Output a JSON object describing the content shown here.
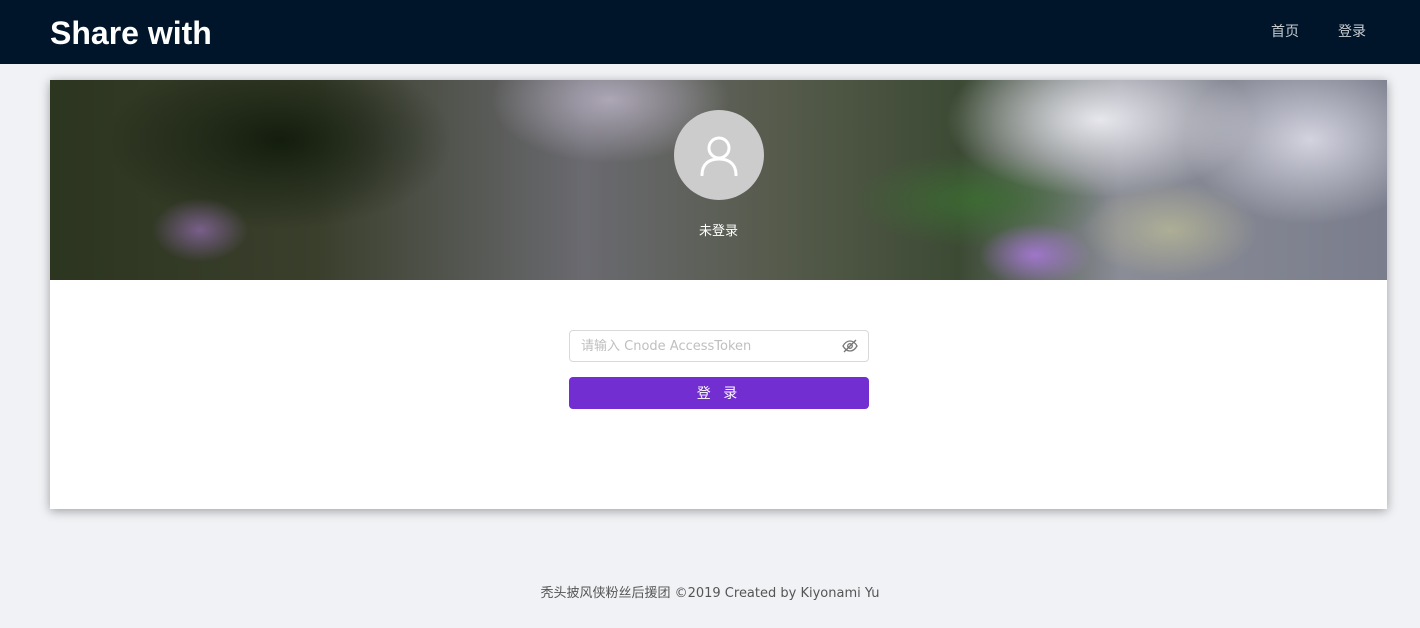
{
  "header": {
    "brand": "Share with",
    "nav": {
      "home": "首页",
      "login": "登录"
    }
  },
  "hero": {
    "avatar_icon": "user-icon",
    "status": "未登录"
  },
  "login_form": {
    "token_placeholder": "请输入 Cnode AccessToken",
    "token_value": "",
    "visibility_icon": "eye-invisible-icon",
    "submit_label": "登 录"
  },
  "footer": {
    "text": "秃头披风侠粉丝后援团 ©2019 Created by Kiyonami Yu"
  },
  "colors": {
    "header_bg": "#001529",
    "page_bg": "#f0f2f5",
    "primary_button": "#722ed1",
    "avatar_bg": "#cccccc"
  }
}
